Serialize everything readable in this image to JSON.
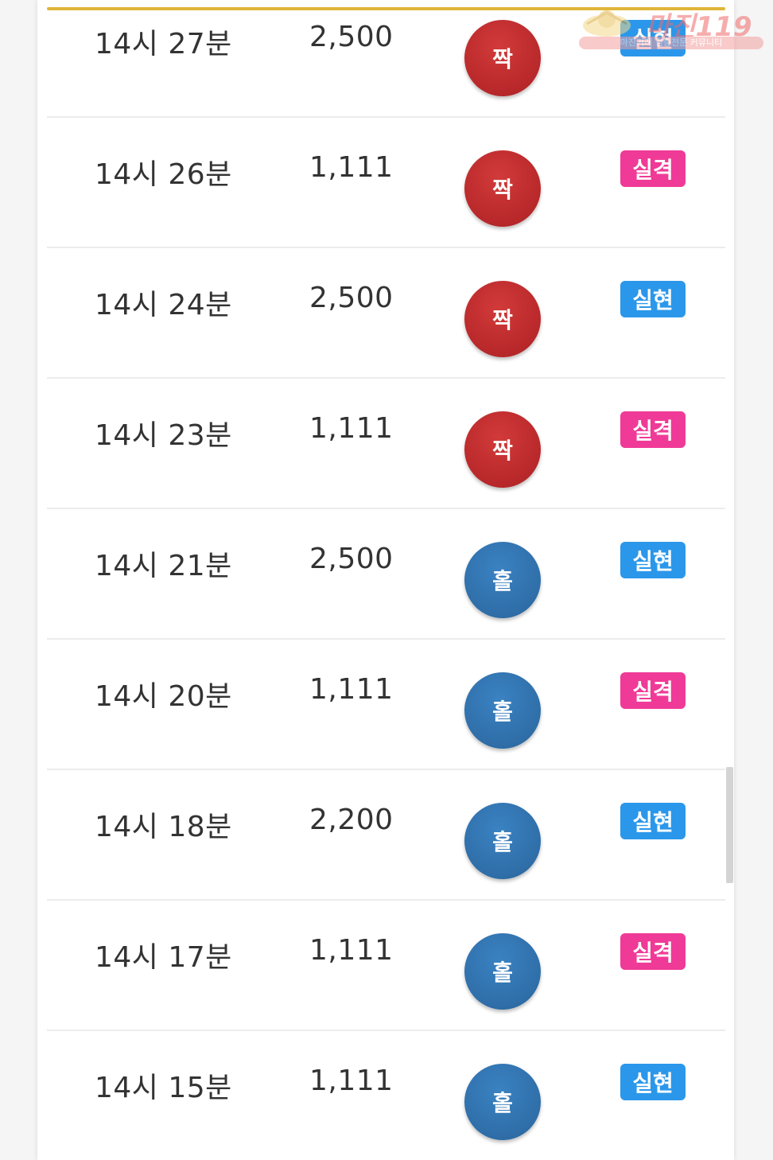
{
  "results": [
    {
      "time": "14시 27분",
      "amount": "2,500",
      "pick": "짝",
      "pick_type": "even",
      "status": "실현",
      "status_type": "hit"
    },
    {
      "time": "14시 26분",
      "amount": "1,111",
      "pick": "짝",
      "pick_type": "even",
      "status": "실격",
      "status_type": "miss"
    },
    {
      "time": "14시 24분",
      "amount": "2,500",
      "pick": "짝",
      "pick_type": "even",
      "status": "실현",
      "status_type": "hit"
    },
    {
      "time": "14시 23분",
      "amount": "1,111",
      "pick": "짝",
      "pick_type": "even",
      "status": "실격",
      "status_type": "miss"
    },
    {
      "time": "14시 21분",
      "amount": "2,500",
      "pick": "홀",
      "pick_type": "odd",
      "status": "실현",
      "status_type": "hit"
    },
    {
      "time": "14시 20분",
      "amount": "1,111",
      "pick": "홀",
      "pick_type": "odd",
      "status": "실격",
      "status_type": "miss"
    },
    {
      "time": "14시 18분",
      "amount": "2,200",
      "pick": "홀",
      "pick_type": "odd",
      "status": "실현",
      "status_type": "hit"
    },
    {
      "time": "14시 17분",
      "amount": "1,111",
      "pick": "홀",
      "pick_type": "odd",
      "status": "실격",
      "status_type": "miss"
    },
    {
      "time": "14시 15분",
      "amount": "1,111",
      "pick": "홀",
      "pick_type": "odd",
      "status": "실현",
      "status_type": "hit"
    }
  ],
  "watermark": {
    "title": "마진119",
    "subtitle": "마진거래 검증전문 커뮤니티"
  },
  "colors": {
    "even_ball": "#b8282a",
    "odd_ball": "#2f6ea8",
    "hit_badge": "#2b97ea",
    "miss_badge": "#f03a97",
    "accent": "#e0b53a"
  }
}
